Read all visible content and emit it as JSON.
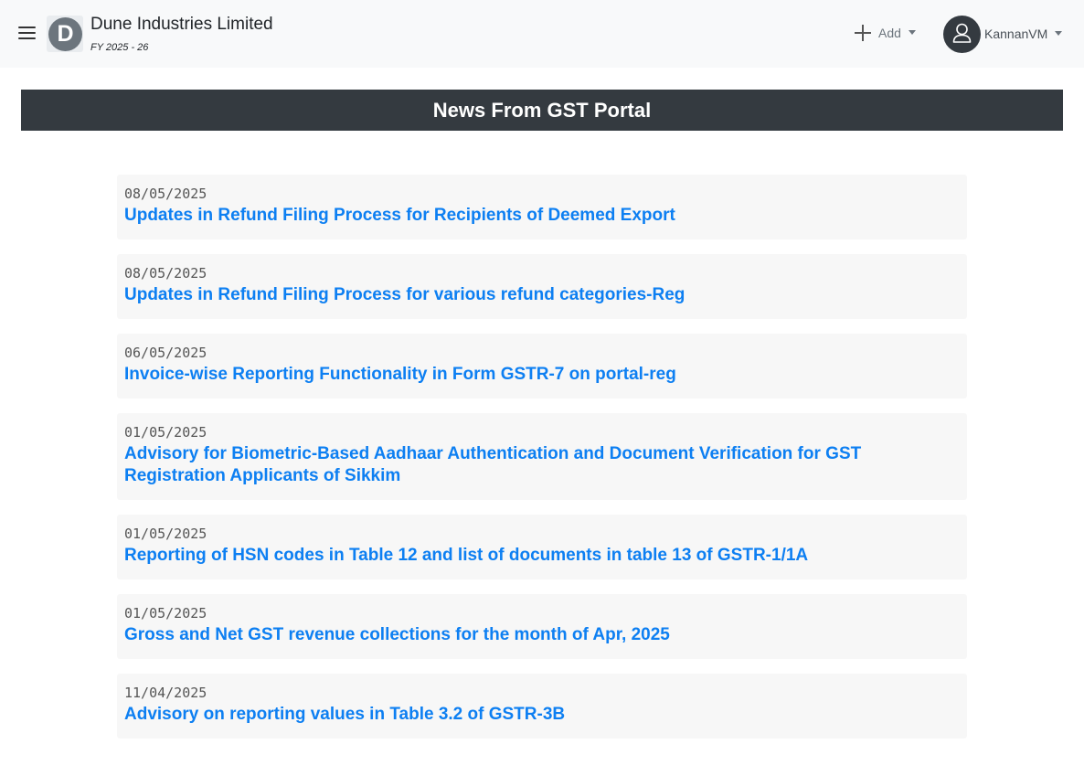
{
  "header": {
    "logo_letter": "D",
    "company_name": "Dune Industries Limited",
    "fiscal_year": "FY 2025 - 26",
    "add_label": "Add",
    "user_name": "KannanVM"
  },
  "banner": {
    "title": "News From GST Portal"
  },
  "news": [
    {
      "date": "08/05/2025",
      "title": "Updates in Refund Filing Process for Recipients of Deemed Export"
    },
    {
      "date": "08/05/2025",
      "title": "Updates in Refund Filing Process for various refund categories-Reg"
    },
    {
      "date": "06/05/2025",
      "title": "Invoice-wise Reporting Functionality in Form GSTR-7 on portal-reg"
    },
    {
      "date": "01/05/2025",
      "title": "Advisory for Biometric-Based Aadhaar Authentication and Document Verification for GST Registration Applicants of Sikkim"
    },
    {
      "date": "01/05/2025",
      "title": "Reporting of HSN codes in Table 12 and list of documents in table 13 of GSTR-1/1A"
    },
    {
      "date": "01/05/2025",
      "title": "Gross and Net GST revenue collections for the month of Apr, 2025"
    },
    {
      "date": "11/04/2025",
      "title": "Advisory on reporting values in Table 3.2 of GSTR-3B"
    }
  ]
}
